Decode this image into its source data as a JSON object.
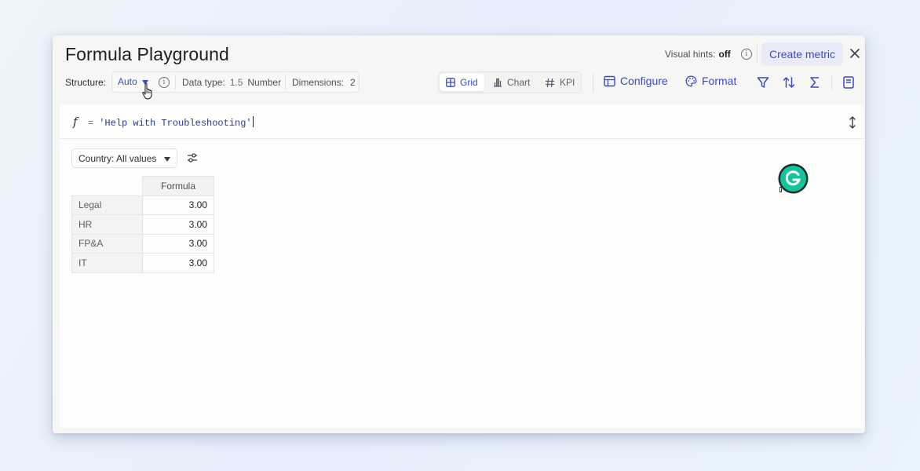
{
  "header": {
    "title": "Formula Playground",
    "visual_hints_label": "Visual hints:",
    "visual_hints_value": "off",
    "create_metric_label": "Create metric"
  },
  "toolbar": {
    "structure_label": "Structure:",
    "structure_value": "Auto",
    "data_type_label": "Data type:",
    "data_type_value": "1.5",
    "data_type_name": "Number",
    "dimensions_label": "Dimensions:",
    "dimensions_value": "2",
    "views": [
      {
        "label": "Grid",
        "icon": "grid-icon",
        "active": true
      },
      {
        "label": "Chart",
        "icon": "bar-chart-icon",
        "active": false
      },
      {
        "label": "KPI",
        "icon": "hash-icon",
        "active": false
      }
    ],
    "configure_label": "Configure",
    "format_label": "Format"
  },
  "formula": {
    "symbol": "f",
    "operator": "=",
    "expression": "'Help with Troubleshooting'"
  },
  "filter": {
    "label": "Country: All values"
  },
  "grid": {
    "column_header": "Formula",
    "rows": [
      {
        "label": "Legal",
        "value": "3.00"
      },
      {
        "label": "HR",
        "value": "3.00"
      },
      {
        "label": "FP&A",
        "value": "3.00"
      },
      {
        "label": "IT",
        "value": "3.00"
      }
    ]
  },
  "colors": {
    "accent": "#3b4cc0",
    "grammarly": "#15c39a"
  }
}
